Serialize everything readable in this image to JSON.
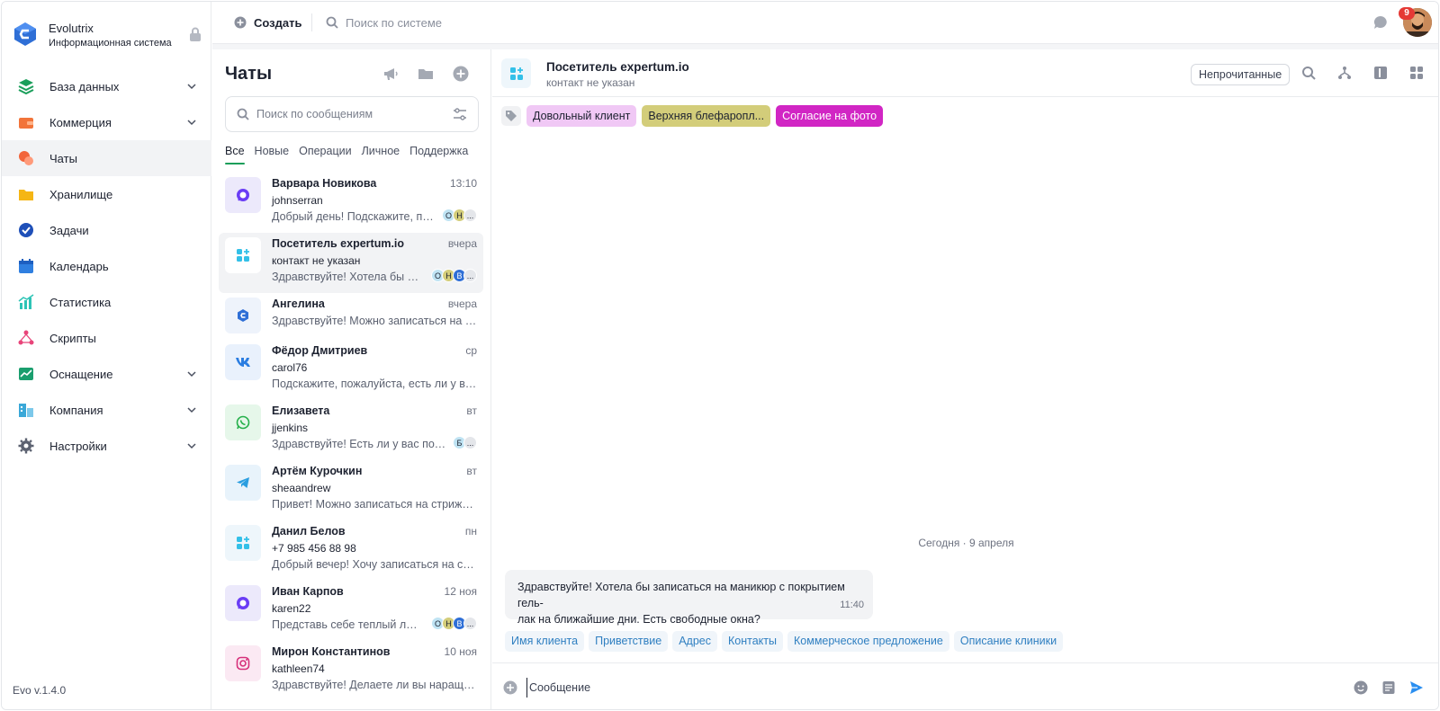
{
  "brand": {
    "name": "Evolutrix",
    "subtitle": "Информационная система"
  },
  "sidebar": {
    "items": [
      {
        "label": "База данных",
        "icon": "database-icon",
        "has_chevron": true
      },
      {
        "label": "Коммерция",
        "icon": "wallet-icon",
        "has_chevron": true
      },
      {
        "label": "Чаты",
        "icon": "chat-icon",
        "active": true
      },
      {
        "label": "Хранилище",
        "icon": "folder-icon"
      },
      {
        "label": "Задачи",
        "icon": "check-circle-icon"
      },
      {
        "label": "Календарь",
        "icon": "calendar-icon"
      },
      {
        "label": "Статистика",
        "icon": "stats-icon"
      },
      {
        "label": "Скрипты",
        "icon": "scripts-icon"
      },
      {
        "label": "Оснащение",
        "icon": "equipment-icon",
        "has_chevron": true
      },
      {
        "label": "Компания",
        "icon": "company-icon",
        "has_chevron": true
      },
      {
        "label": "Настройки",
        "icon": "gear-icon",
        "has_chevron": true
      }
    ],
    "version": "Evo v.1.4.0"
  },
  "topbar": {
    "create_label": "Создать",
    "search_placeholder": "Поиск по системе",
    "notification_count": "9"
  },
  "chatlist": {
    "title": "Чаты",
    "search_placeholder": "Поиск по сообщениям",
    "tabs": [
      "Все",
      "Новые",
      "Операции",
      "Личное",
      "Поддержка"
    ],
    "items": [
      {
        "name": "Варвара Новикова",
        "time": "13:10",
        "sub": "johnserran",
        "preview": "Добрый день! Подскажите, пож...",
        "source": "max",
        "badges": [
          "О",
          "Н",
          "..."
        ]
      },
      {
        "name": "Посетитель expertum.io",
        "time": "вчера",
        "sub": "контакт не указан",
        "preview": "Здравствуйте! Хотела бы запис...",
        "source": "widget",
        "badges": [
          "О",
          "Н",
          "В",
          "..."
        ],
        "active": true
      },
      {
        "name": "Ангелина",
        "time": "вчера",
        "sub": "",
        "preview": "Здравствуйте! Можно записаться на ма...",
        "source": "evo"
      },
      {
        "name": "Фёдор Дмитриев",
        "time": "ср",
        "sub": "carol76",
        "preview": "Подскажите, пожалуйста, есть ли у вас с...",
        "source": "vk"
      },
      {
        "name": "Елизавета",
        "time": "вт",
        "sub": "jjenkins",
        "preview": "Здравствуйте! Есть ли у вас подар...",
        "source": "whatsapp",
        "badges": [
          "Б",
          "..."
        ]
      },
      {
        "name": "Артём Курочкин",
        "time": "вт",
        "sub": "sheaandrew",
        "preview": "Привет! Можно записаться на стрижку и...",
        "source": "telegram"
      },
      {
        "name": "Данил Белов",
        "time": "пн",
        "sub": "+7 985 456 88 98",
        "preview": "Добрый вечер! Хочу записаться на свад...",
        "source": "widget"
      },
      {
        "name": "Иван Карпов",
        "time": "12 ноя",
        "sub": "karen22",
        "preview": "Представь себе теплый летн...",
        "source": "max",
        "badges": [
          "О",
          "Н",
          "В",
          "..."
        ]
      },
      {
        "name": "Мирон Константинов",
        "time": "10 ноя",
        "sub": "kathleen74",
        "preview": "Здравствуйте! Делаете ли вы наращива...",
        "source": "instagram"
      }
    ]
  },
  "chat": {
    "title": "Посетитель expertum.io",
    "subtitle": "контакт не указан",
    "unread_label": "Непрочитанные",
    "tags": [
      {
        "label": "Довольный клиент",
        "bg": "#f0c8f5",
        "color": "#1d2230"
      },
      {
        "label": "Верхняя блефаропл...",
        "bg": "#d3cd7a",
        "color": "#1d2230"
      },
      {
        "label": "Согласие на фото",
        "bg": "#d126c4",
        "color": "#ffffff"
      }
    ],
    "date_separator": "Сегодня · 9 апреля",
    "message": {
      "text_line1": "Здравствуйте! Хотела бы записаться на маникюр с покрытием гель-",
      "text_line2": "лак на ближайшие дни. Есть свободные окна?",
      "time": "11:40"
    },
    "quick_replies": [
      "Имя клиента",
      "Приветствие",
      "Адрес",
      "Контакты",
      "Коммерческое предложение",
      "Описание клиники"
    ],
    "composer_placeholder": "Сообщение"
  },
  "colors": {
    "accent_green": "#1a9e5a",
    "link_blue": "#2f7fc1",
    "badge_red": "#e53935"
  }
}
